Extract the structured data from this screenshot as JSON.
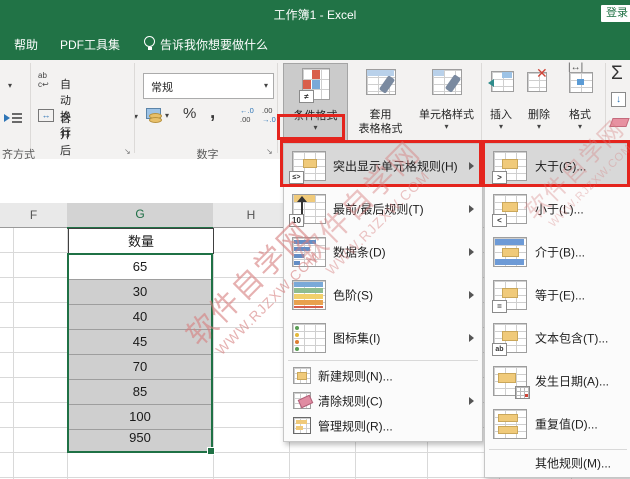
{
  "title_bar": {
    "title": "工作簿1 - Excel",
    "sign_in": "登录"
  },
  "tab_row": {
    "help": "帮助",
    "pdf_tools": "PDF工具集",
    "tell_me": "告诉我你想要做什么"
  },
  "ribbon": {
    "alignment": {
      "wrap_text": "自动换行",
      "merge_center": "合并后居中",
      "group_label": "齐方式"
    },
    "number": {
      "format_value": "常规",
      "percent": "%",
      "comma": ",",
      "inc_dec_top": "←.0",
      "inc_dec_bot": ".00",
      "dec_dec_top": ".00",
      "dec_dec_bot": "→.0",
      "group_label": "数字"
    },
    "styles": {
      "conditional_format": "条件格式",
      "format_table_line1": "套用",
      "format_table_line2": "表格格式",
      "cell_styles": "单元格样式"
    },
    "cells": {
      "insert": "插入",
      "delete": "删除",
      "format": "格式",
      "delete_x": "✕"
    },
    "editing": {
      "autosum": "Σ",
      "fill": "↓"
    }
  },
  "sheet": {
    "columns": [
      "F",
      "G",
      "H"
    ],
    "header_cell": "数量",
    "values": [
      "65",
      "30",
      "40",
      "45",
      "70",
      "85",
      "100",
      "950"
    ]
  },
  "menu": {
    "items": [
      {
        "label": "突出显示单元格规则(H)"
      },
      {
        "label": "最前/最后规则(T)"
      },
      {
        "label": "数据条(D)"
      },
      {
        "label": "色阶(S)"
      },
      {
        "label": "图标集(I)"
      },
      {
        "label": "新建规则(N)..."
      },
      {
        "label": "清除规则(C)"
      },
      {
        "label": "管理规则(R)..."
      }
    ],
    "top_bottom_badge": "10",
    "hlcr_badge": "≤>"
  },
  "submenu": {
    "items": [
      {
        "label": "大于(G)...",
        "badge": ">"
      },
      {
        "label": "小于(L)...",
        "badge": "<"
      },
      {
        "label": "介于(B)..."
      },
      {
        "label": "等于(E)...",
        "badge": "="
      },
      {
        "label": "文本包含(T)...",
        "badge": "ab"
      },
      {
        "label": "发生日期(A)..."
      },
      {
        "label": "重复值(D)..."
      },
      {
        "label": "其他规则(M)..."
      }
    ]
  },
  "watermark": {
    "line1": "软件自学网",
    "line2": "WWW.RJZXW.COM"
  },
  "colors": {
    "excel_green": "#217346",
    "annotation_red": "#e4241d",
    "selection_fill": "#cfcfcf",
    "menu_highlight": "#d8d8d8",
    "watermark_pink": "#d67e7e",
    "highlight_yellow": "#f0ca7a"
  }
}
